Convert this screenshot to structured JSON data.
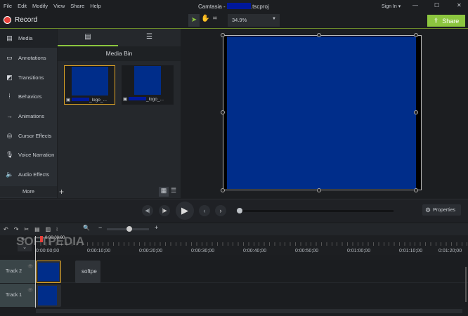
{
  "menu": [
    "File",
    "Edit",
    "Modify",
    "View",
    "Share",
    "Help"
  ],
  "title": {
    "prefix": "Camtasia - ",
    "suffix": ".tscproj"
  },
  "signin": "Sign In ▾",
  "window_controls": [
    "—",
    "☐",
    "✕"
  ],
  "record": "Record",
  "zoom": "34.9%",
  "share": "Share",
  "sidebar": {
    "items": [
      {
        "label": "Media",
        "icon": "film-icon"
      },
      {
        "label": "Annotations",
        "icon": "annotation-icon"
      },
      {
        "label": "Transitions",
        "icon": "transition-icon"
      },
      {
        "label": "Behaviors",
        "icon": "behavior-icon"
      },
      {
        "label": "Animations",
        "icon": "animation-icon"
      },
      {
        "label": "Cursor Effects",
        "icon": "cursor-icon"
      },
      {
        "label": "Voice Narration",
        "icon": "microphone-icon"
      },
      {
        "label": "Audio Effects",
        "icon": "speaker-icon"
      }
    ],
    "more": "More"
  },
  "bin": {
    "title": "Media Bin",
    "items": [
      {
        "label": "_logo_..."
      },
      {
        "label": "_logo_..."
      }
    ]
  },
  "properties": "Properties",
  "playhead": "0:00:00;00",
  "ruler": [
    "0:00:00;00",
    "0:00:10;00",
    "0:00:20;00",
    "0:00:30;00",
    "0:00:40;00",
    "0:00:50;00",
    "0:01:00;00",
    "0:01:10;00",
    "0:01:20;00"
  ],
  "tracks": [
    "Track 2",
    "Track 1"
  ],
  "clip_text": "softpe",
  "watermark": "SOFTPEDIA",
  "colors": {
    "accent": "#8cc63f",
    "media_blue": "#002d8a",
    "selection": "#e0a526",
    "record": "#e8403a"
  }
}
